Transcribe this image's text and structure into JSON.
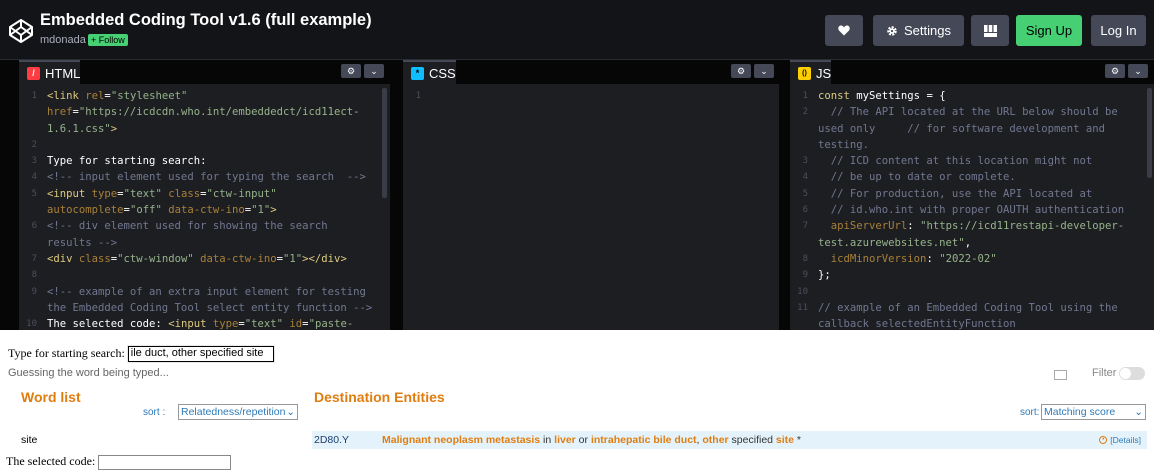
{
  "header": {
    "title": "Embedded Coding Tool v1.6 (full example)",
    "author": "mdonada",
    "follow_label": "+ Follow",
    "settings_label": "Settings",
    "signup_label": "Sign Up",
    "login_label": "Log In"
  },
  "panes": {
    "html": {
      "tab_label": "HTML",
      "icon_letter": "/",
      "lines": [
        {
          "n": "1",
          "segs": [
            [
              "t-tag",
              "<link "
            ],
            [
              "t-attr",
              "rel"
            ],
            [
              "t-plain",
              "="
            ],
            [
              "t-str",
              "\"stylesheet\""
            ]
          ]
        },
        {
          "n": "",
          "segs": [
            [
              "t-attr",
              "href"
            ],
            [
              "t-plain",
              "="
            ],
            [
              "t-str",
              "\"https://icdcdn.who.int/embeddedct/icd11ect-"
            ]
          ]
        },
        {
          "n": "",
          "segs": [
            [
              "t-str",
              "1.6.1.css\""
            ],
            [
              "t-tag",
              ">"
            ]
          ]
        },
        {
          "n": "2",
          "segs": []
        },
        {
          "n": "3",
          "segs": [
            [
              "t-plain",
              "Type for starting search:"
            ]
          ]
        },
        {
          "n": "4",
          "segs": [
            [
              "t-com",
              "<!-- input element used for typing the search  -->"
            ]
          ]
        },
        {
          "n": "5",
          "segs": [
            [
              "t-tag",
              "<input "
            ],
            [
              "t-attr",
              "type"
            ],
            [
              "t-plain",
              "="
            ],
            [
              "t-str",
              "\"text\" "
            ],
            [
              "t-attr",
              "class"
            ],
            [
              "t-plain",
              "="
            ],
            [
              "t-str",
              "\"ctw-input\""
            ]
          ]
        },
        {
          "n": "",
          "segs": [
            [
              "t-attr",
              "autocomplete"
            ],
            [
              "t-plain",
              "="
            ],
            [
              "t-str",
              "\"off\" "
            ],
            [
              "t-attr",
              "data-ctw-ino"
            ],
            [
              "t-plain",
              "="
            ],
            [
              "t-str",
              "\"1\""
            ],
            [
              "t-tag",
              ">"
            ]
          ]
        },
        {
          "n": "6",
          "segs": [
            [
              "t-com",
              "<!-- div element used for showing the search"
            ]
          ]
        },
        {
          "n": "",
          "segs": [
            [
              "t-com",
              "results -->"
            ]
          ]
        },
        {
          "n": "7",
          "segs": [
            [
              "t-tag",
              "<div "
            ],
            [
              "t-attr",
              "class"
            ],
            [
              "t-plain",
              "="
            ],
            [
              "t-str",
              "\"ctw-window\" "
            ],
            [
              "t-attr",
              "data-ctw-ino"
            ],
            [
              "t-plain",
              "="
            ],
            [
              "t-str",
              "\"1\""
            ],
            [
              "t-tag",
              "></div>"
            ]
          ]
        },
        {
          "n": "8",
          "segs": []
        },
        {
          "n": "9",
          "segs": [
            [
              "t-com",
              "<!-- example of an extra input element for testing"
            ]
          ]
        },
        {
          "n": "",
          "segs": [
            [
              "t-com",
              "the Embedded Coding Tool select entity function -->"
            ]
          ]
        },
        {
          "n": "10",
          "segs": [
            [
              "t-plain",
              "The selected code: "
            ],
            [
              "t-tag",
              "<input "
            ],
            [
              "t-attr",
              "type"
            ],
            [
              "t-plain",
              "="
            ],
            [
              "t-str",
              "\"text\" "
            ],
            [
              "t-attr",
              "id"
            ],
            [
              "t-plain",
              "="
            ],
            [
              "t-str",
              "\"paste-"
            ]
          ]
        }
      ]
    },
    "css": {
      "tab_label": "CSS",
      "icon_letter": "*",
      "lines": [
        {
          "n": "1",
          "segs": []
        }
      ]
    },
    "js": {
      "tab_label": "JS",
      "icon_letter": "()",
      "lines": [
        {
          "n": "1",
          "segs": [
            [
              "t-kw",
              "const "
            ],
            [
              "t-plain",
              "mySettings = {"
            ]
          ]
        },
        {
          "n": "2",
          "segs": [
            [
              "t-com",
              "  // The API located at the URL below should be"
            ]
          ]
        },
        {
          "n": "",
          "segs": [
            [
              "t-com",
              "used only     // for software development and"
            ]
          ]
        },
        {
          "n": "",
          "segs": [
            [
              "t-com",
              "testing."
            ]
          ]
        },
        {
          "n": "3",
          "segs": [
            [
              "t-com",
              "  // ICD content at this location might not"
            ]
          ]
        },
        {
          "n": "4",
          "segs": [
            [
              "t-com",
              "  // be up to date or complete."
            ]
          ]
        },
        {
          "n": "5",
          "segs": [
            [
              "t-com",
              "  // For production, use the API located at"
            ]
          ]
        },
        {
          "n": "6",
          "segs": [
            [
              "t-com",
              "  // id.who.int with proper OAUTH authentication"
            ]
          ]
        },
        {
          "n": "7",
          "segs": [
            [
              "t-attr",
              "  apiServerUrl"
            ],
            [
              "t-plain",
              ": "
            ],
            [
              "t-str",
              "\"https://icd11restapi-developer-"
            ]
          ]
        },
        {
          "n": "",
          "segs": [
            [
              "t-str",
              "test.azurewebsites.net\""
            ],
            [
              "t-plain",
              ","
            ]
          ]
        },
        {
          "n": "8",
          "segs": [
            [
              "t-attr",
              "  icdMinorVersion"
            ],
            [
              "t-plain",
              ": "
            ],
            [
              "t-str",
              "\"2022-02\""
            ]
          ]
        },
        {
          "n": "9",
          "segs": [
            [
              "t-plain",
              "};"
            ]
          ]
        },
        {
          "n": "10",
          "segs": []
        },
        {
          "n": "11",
          "segs": [
            [
              "t-com",
              "// example of an Embedded Coding Tool using the"
            ]
          ]
        },
        {
          "n": "",
          "segs": [
            [
              "t-com",
              "callback selectedEntityFunction"
            ]
          ]
        }
      ]
    }
  },
  "preview": {
    "search_label": "Type for starting search:",
    "search_value": "ile duct, other specified site",
    "guess_text": "Guessing the word being typed...",
    "filter_label": "Filter",
    "word_list_heading": "Word list",
    "word_sort_label": "sort :",
    "word_sort_value": "Relatedness/repetition",
    "dest_heading": "Destination Entities",
    "dest_sort_label": "sort:",
    "dest_sort_value": "Matching score",
    "word_items": [
      "site"
    ],
    "result_code": "2D80.Y",
    "result_title": [
      [
        "t-strong",
        "Malignant neoplasm metastasis"
      ],
      [
        "t-dark",
        " in "
      ],
      [
        "t-strong",
        "liver"
      ],
      [
        "t-dark",
        " or "
      ],
      [
        "t-strong",
        "intrahepatic bile duct"
      ],
      [
        "t-dark",
        ", "
      ],
      [
        "t-strong",
        "other"
      ],
      [
        "t-dark",
        " specified "
      ],
      [
        "t-strong",
        "site"
      ],
      [
        "t-dark",
        " *"
      ]
    ],
    "details_label": "[Details]",
    "selected_code_label": "The selected code:"
  }
}
